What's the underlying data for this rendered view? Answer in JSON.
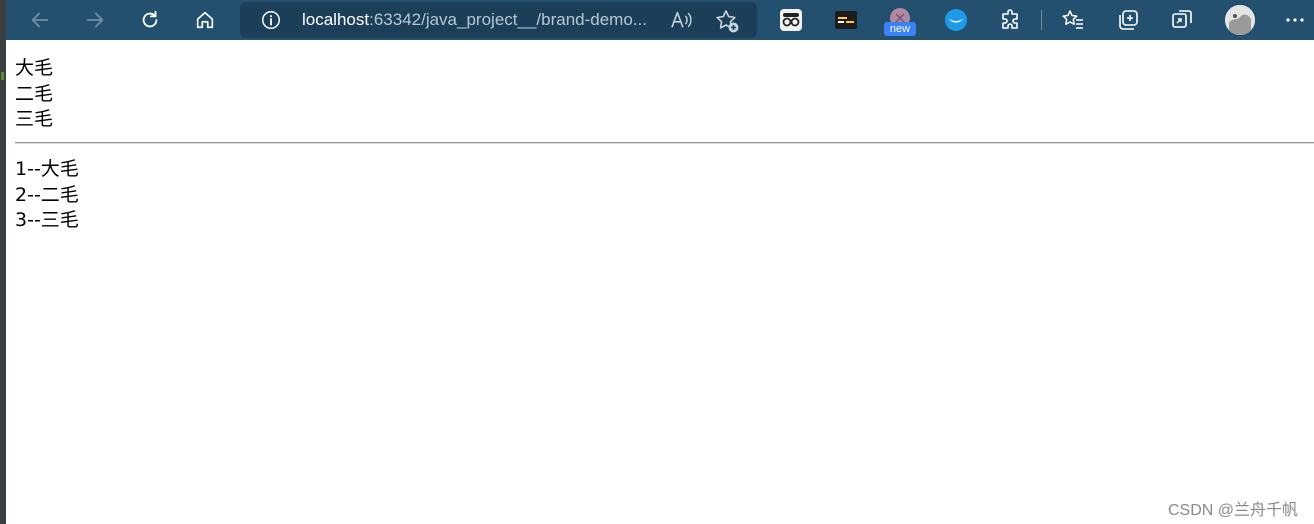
{
  "browser": {
    "address_host": "localhost",
    "address_rest": ":63342/java_project__/brand-demo...",
    "new_badge": "new",
    "accent_color": "#23506e",
    "icons": [
      "back-icon",
      "forward-icon",
      "refresh-icon",
      "home-icon",
      "site-info-icon",
      "read-aloud-icon",
      "add-favorite-icon",
      "extension-glasses-icon",
      "extension-console-icon",
      "extension-new-icon",
      "extension-bird-icon",
      "extensions-puzzle-icon",
      "favorites-icon",
      "collections-icon",
      "share-icon",
      "profile-avatar",
      "more-icon"
    ]
  },
  "page": {
    "list_a": [
      "大毛",
      "二毛",
      "三毛"
    ],
    "list_b": [
      "1--大毛",
      "2--二毛",
      "3--三毛"
    ]
  },
  "watermark": "CSDN @兰舟千帆"
}
